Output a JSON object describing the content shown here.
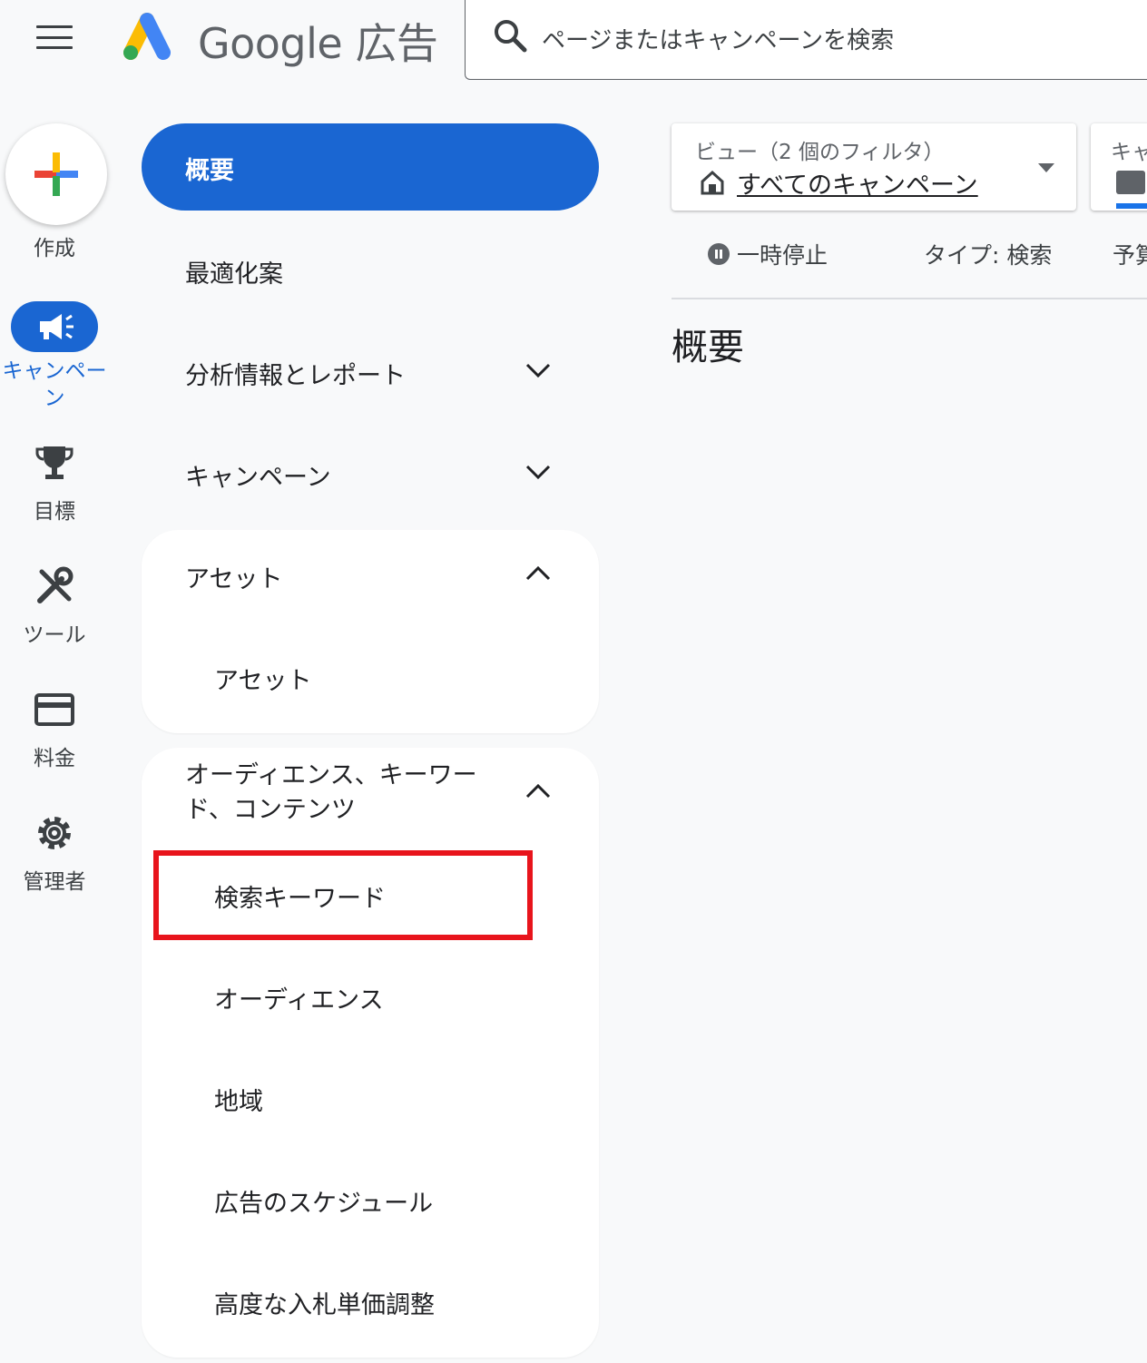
{
  "header": {
    "brand_name": "Google 広告",
    "search_placeholder": "ページまたはキャンペーンを検索"
  },
  "rail": {
    "create_label": "作成",
    "items": [
      {
        "label": "キャンペーン",
        "icon": "megaphone-icon",
        "active": true
      },
      {
        "label": "目標",
        "icon": "trophy-icon"
      },
      {
        "label": "ツール",
        "icon": "tools-icon"
      },
      {
        "label": "料金",
        "icon": "credit-card-icon"
      },
      {
        "label": "管理者",
        "icon": "gear-icon"
      }
    ]
  },
  "nav": {
    "overview": "概要",
    "recommendations": "最適化案",
    "insights_reports": "分析情報とレポート",
    "campaigns": "キャンペーン",
    "assets_group": {
      "label": "アセット",
      "items": [
        "アセット"
      ]
    },
    "audience_group": {
      "label_line1": "オーディエンス、キーワー",
      "label_line2": "ド、コンテンツ",
      "items": [
        "検索キーワード",
        "オーディエンス",
        "地域",
        "広告のスケジュール",
        "高度な入札単価調整"
      ]
    }
  },
  "content": {
    "view_filter_label": "ビュー（2 個のフィルタ）",
    "view_filter_value": "すべてのキャンペーン",
    "campaign_selector_label": "キャ",
    "status_paused": "一時停止",
    "status_type": "タイプ: 検索",
    "status_budget": "予算",
    "page_title": "概要"
  },
  "colors": {
    "accent_blue": "#1a66d2",
    "highlight_red": "#e8141c",
    "background": "#f8f9fa"
  }
}
